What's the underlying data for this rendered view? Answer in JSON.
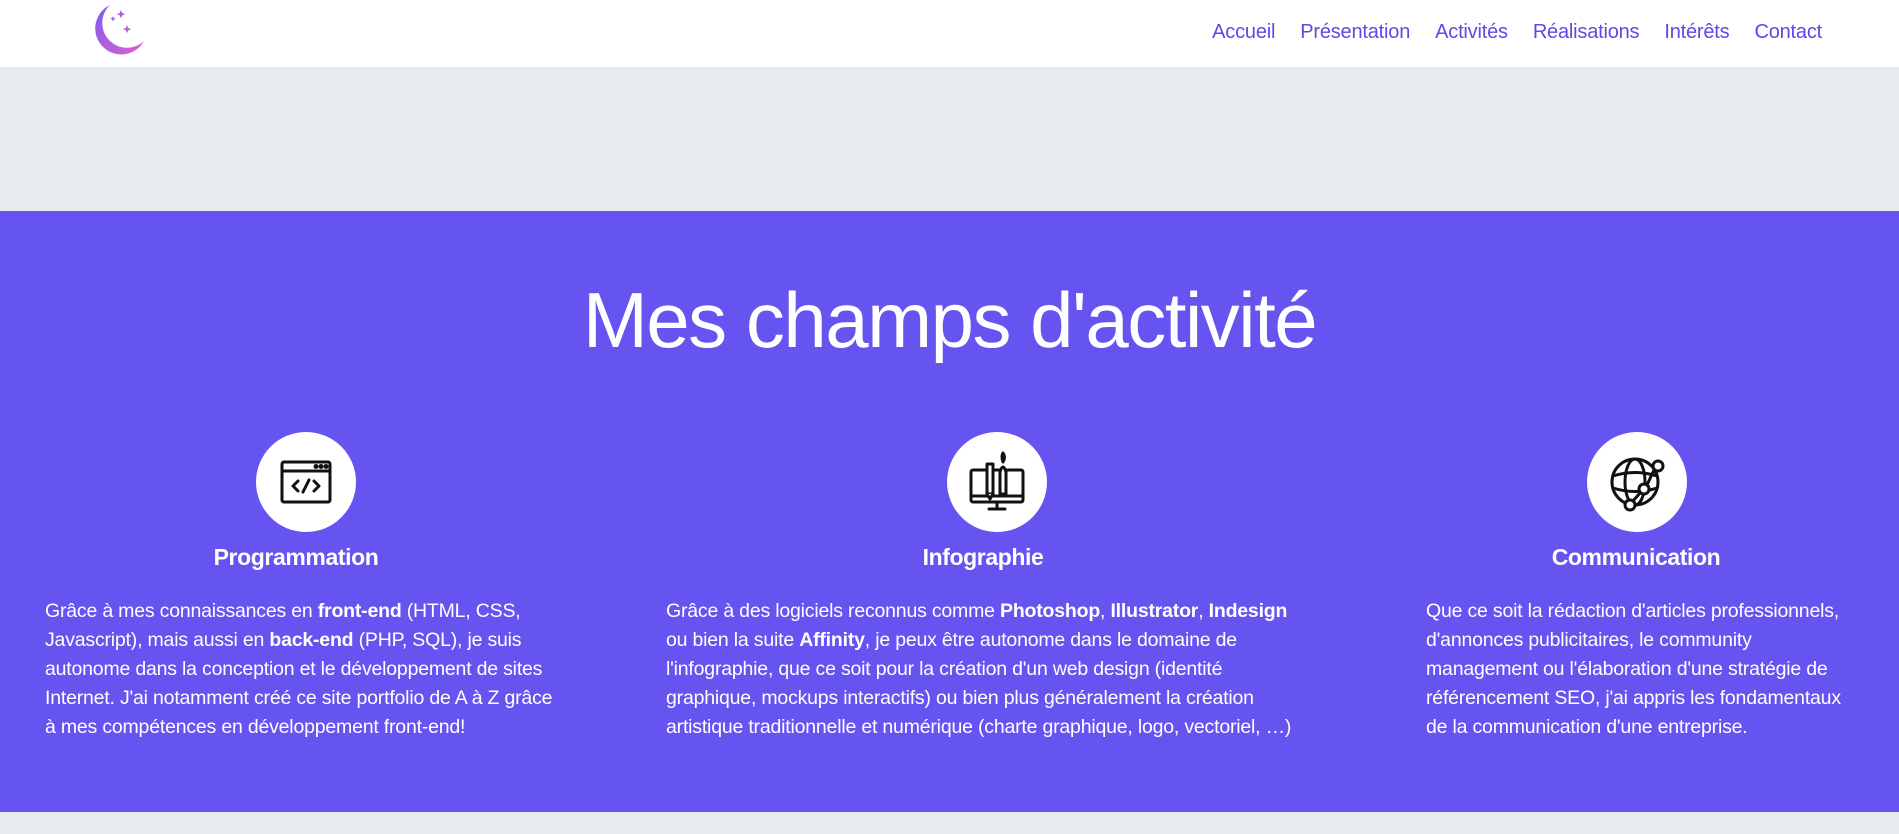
{
  "header": {
    "logo_icon": "crescent-moon-stars-icon",
    "nav": [
      {
        "label": "Accueil"
      },
      {
        "label": "Présentation"
      },
      {
        "label": "Activités"
      },
      {
        "label": "Réalisations"
      },
      {
        "label": "Intérêts"
      },
      {
        "label": "Contact"
      }
    ]
  },
  "activities": {
    "title": "Mes champs d'activité",
    "columns": [
      {
        "icon": "code-window-icon",
        "heading": "Programmation",
        "text": [
          "Grâce à mes connaissances en ",
          "front-end",
          " (HTML, CSS, Javascript), mais aussi en ",
          "back-end",
          " (PHP, SQL), je suis autonome dans la conception et le développement de sites Internet. J'ai notamment créé ce site portfolio de A à Z grâce à mes compétences en développement front-end!"
        ]
      },
      {
        "icon": "design-monitor-icon",
        "heading": "Infographie",
        "text": [
          "Grâce à des logiciels reconnus comme ",
          "Photoshop",
          ", ",
          "Illustrator",
          ", ",
          "Indesign",
          " ou bien la suite ",
          "Affinity",
          ", je peux être autonome dans le domaine de l'infographie, que ce soit pour la création d'un web design (identité graphique, mockups interactifs) ou bien plus généralement la création artistique traditionnelle et numérique (charte graphique, logo, vectoriel, …)"
        ]
      },
      {
        "icon": "globe-network-icon",
        "heading": "Communication",
        "text": [
          "Que ce soit la rédaction d'articles professionnels, d'annonces publicitaires, le community management ou l'élaboration d'une stratégie de référencement SEO, j'ai appris les fondamentaux de la communication d'une entreprise."
        ]
      }
    ]
  },
  "colors": {
    "accent": "#6654f1",
    "nav_text": "#5b4ae6",
    "background": "#e8ecf1"
  }
}
